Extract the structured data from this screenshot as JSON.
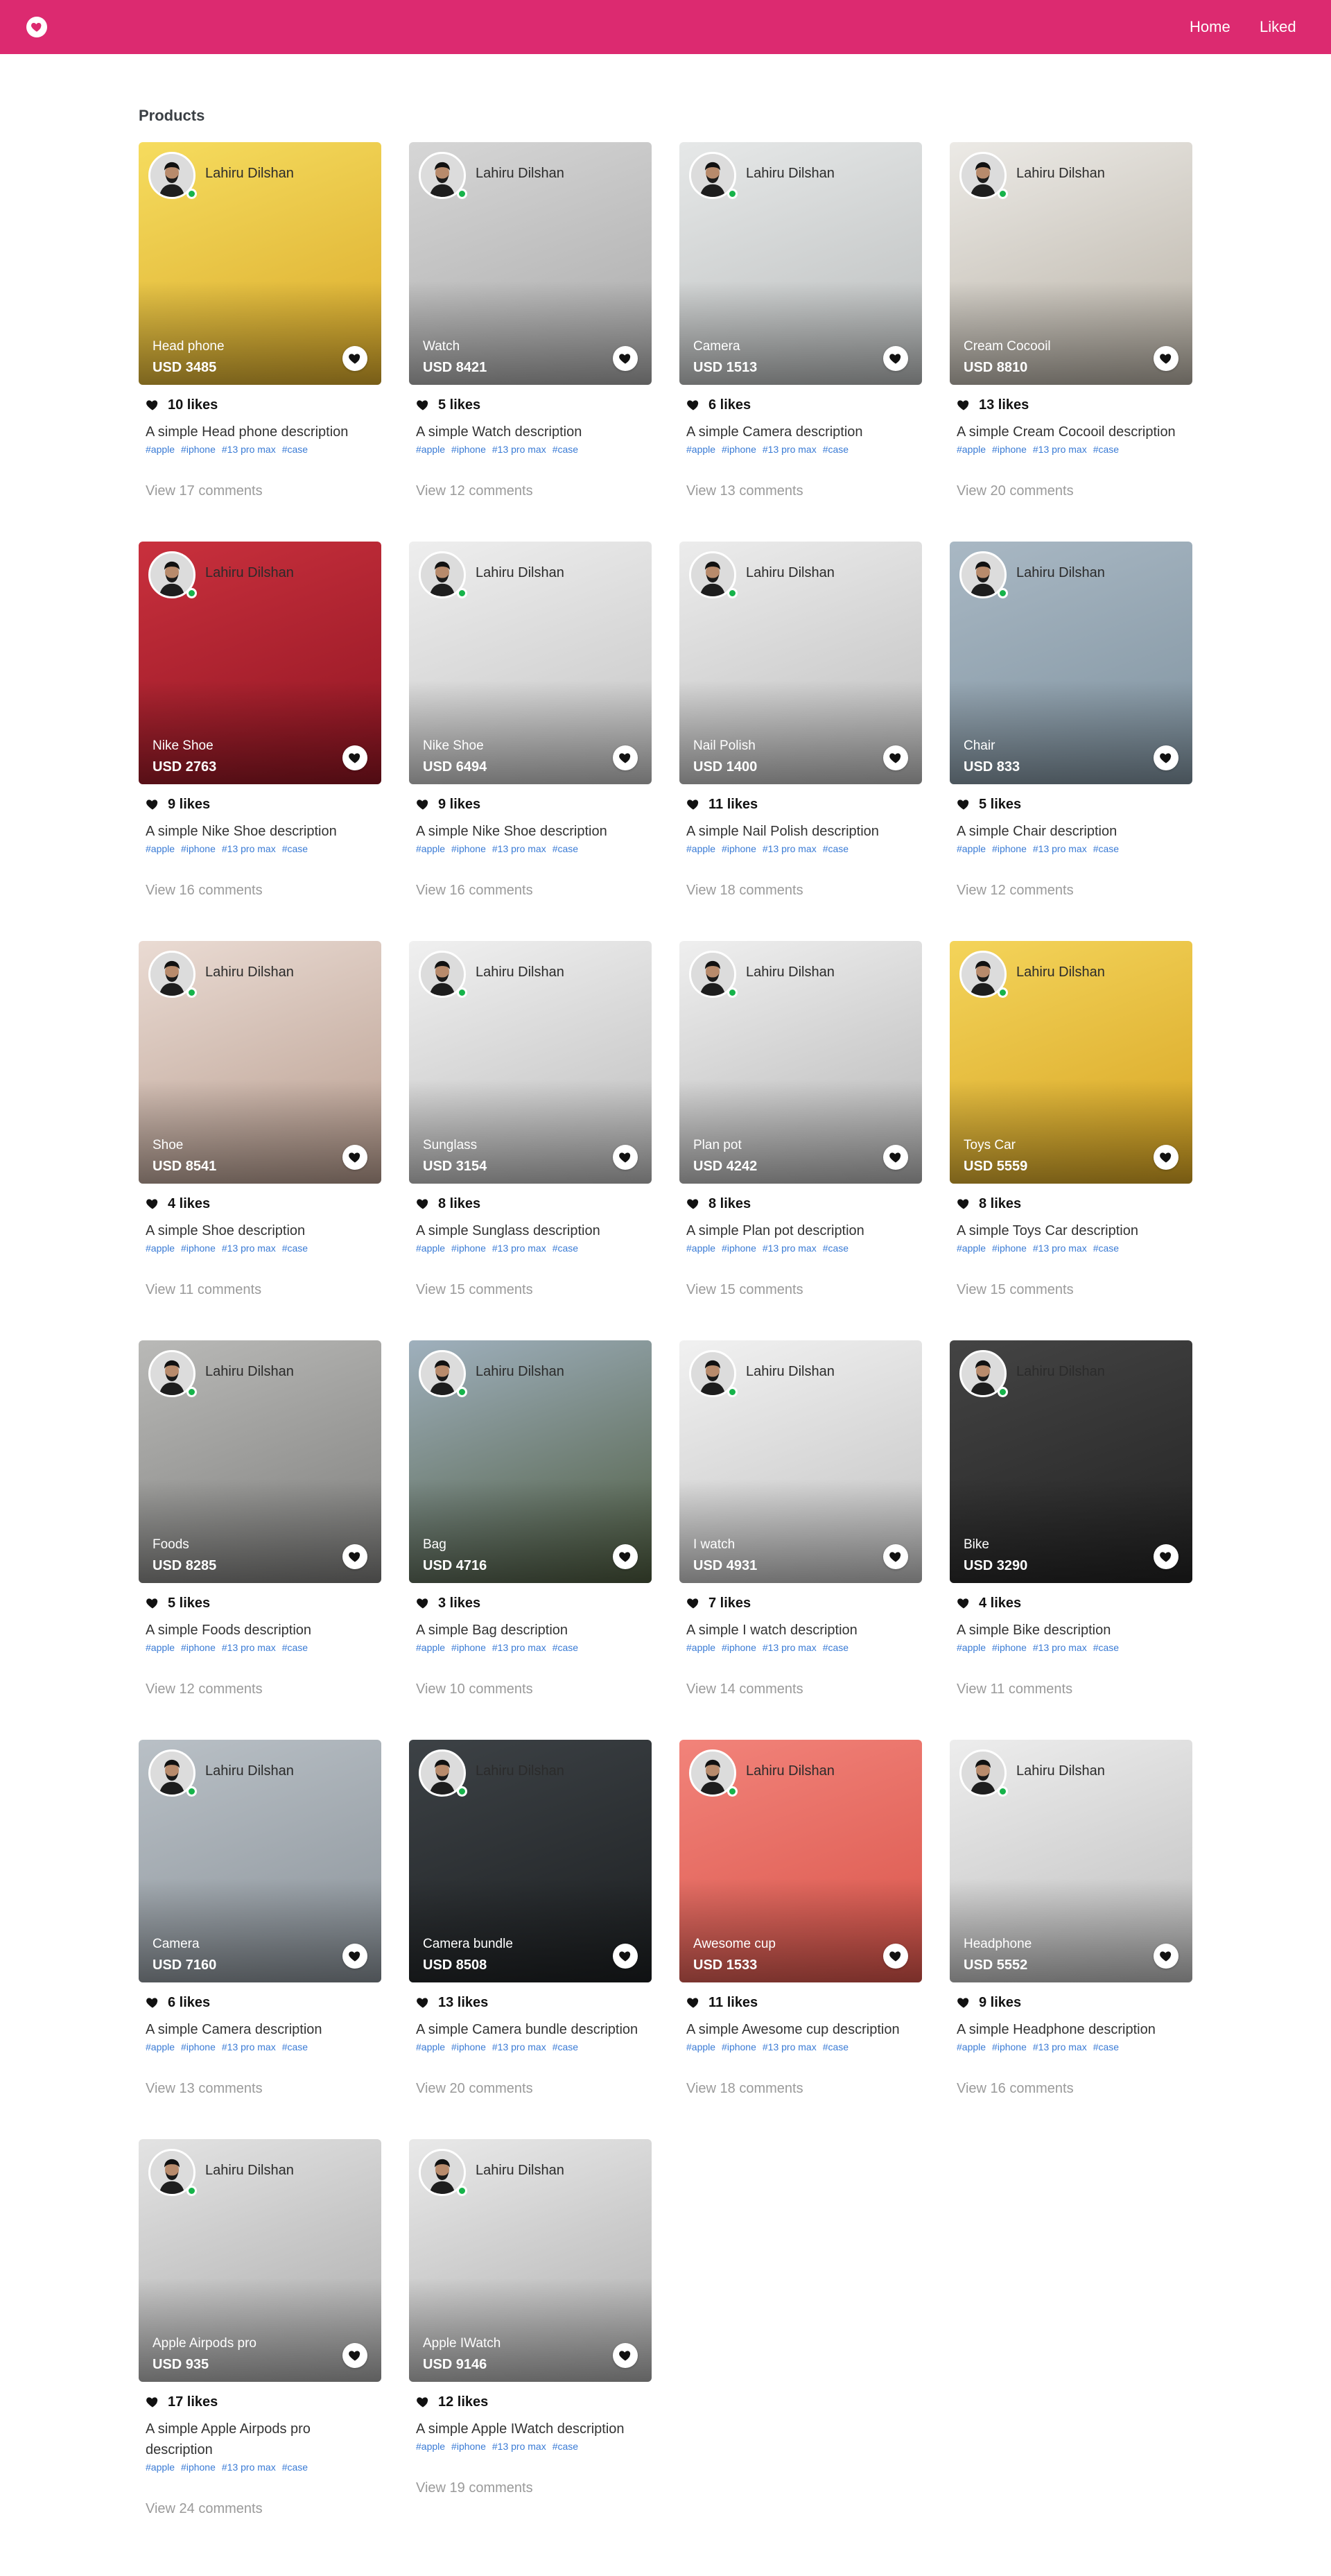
{
  "navbar": {
    "home": "Home",
    "liked": "Liked"
  },
  "page": {
    "title": "Products"
  },
  "author": "Lahiru Dilshan",
  "tags": [
    "#apple",
    "#iphone",
    "#13 pro max",
    "#case"
  ],
  "colors": {
    "brand": "#dc2a70",
    "online": "#16b34a",
    "tag": "#3a7bd5"
  },
  "products": [
    {
      "name": "Head phone",
      "price": "USD 3485",
      "likes": "10 likes",
      "description": "A simple Head phone description",
      "comments": "View 17 comments",
      "bg": [
        "#f6dc5e",
        "#d9a92a"
      ]
    },
    {
      "name": "Watch",
      "price": "USD 8421",
      "likes": "5 likes",
      "description": "A simple Watch description",
      "comments": "View 12 comments",
      "bg": [
        "#d6d6d6",
        "#a9a9a9"
      ]
    },
    {
      "name": "Camera",
      "price": "USD 1513",
      "likes": "6 likes",
      "description": "A simple Camera description",
      "comments": "View 13 comments",
      "bg": [
        "#e6e8e8",
        "#b9bcbc"
      ]
    },
    {
      "name": "Cream Cocooil",
      "price": "USD 8810",
      "likes": "13 likes",
      "description": "A simple Cream Cocooil description",
      "comments": "View 20 comments",
      "bg": [
        "#eceae6",
        "#b7b0a4"
      ]
    },
    {
      "name": "Nike Shoe",
      "price": "USD 2763",
      "likes": "9 likes",
      "description": "A simple Nike Shoe description",
      "comments": "View 16 comments",
      "bg": [
        "#c9303d",
        "#8f1522"
      ]
    },
    {
      "name": "Nike Shoe",
      "price": "USD 6494",
      "likes": "9 likes",
      "description": "A simple Nike Shoe description",
      "comments": "View 16 comments",
      "bg": [
        "#eeeeee",
        "#c4c4c4"
      ]
    },
    {
      "name": "Nail Polish",
      "price": "USD 1400",
      "likes": "11 likes",
      "description": "A simple Nail Polish description",
      "comments": "View 18 comments",
      "bg": [
        "#ececec",
        "#bdbdbd"
      ]
    },
    {
      "name": "Chair",
      "price": "USD 833",
      "likes": "5 likes",
      "description": "A simple Chair description",
      "comments": "View 12 comments",
      "bg": [
        "#a9b8c4",
        "#7f929f"
      ]
    },
    {
      "name": "Shoe",
      "price": "USD 8541",
      "likes": "4 likes",
      "description": "A simple Shoe description",
      "comments": "View 11 comments",
      "bg": [
        "#eadbd3",
        "#b79c8e"
      ]
    },
    {
      "name": "Sunglass",
      "price": "USD 3154",
      "likes": "8 likes",
      "description": "A simple Sunglass description",
      "comments": "View 15 comments",
      "bg": [
        "#f0f0f0",
        "#bcbcbc"
      ]
    },
    {
      "name": "Plan pot",
      "price": "USD 4242",
      "likes": "8 likes",
      "description": "A simple Plan pot description",
      "comments": "View 15 comments",
      "bg": [
        "#efefef",
        "#b5b5b5"
      ]
    },
    {
      "name": "Toys Car",
      "price": "USD 5559",
      "likes": "8 likes",
      "description": "A simple Toys Car description",
      "comments": "View 15 comments",
      "bg": [
        "#f4d45a",
        "#d6a322"
      ]
    },
    {
      "name": "Foods",
      "price": "USD 8285",
      "likes": "5 likes",
      "description": "A simple Foods description",
      "comments": "View 12 comments",
      "bg": [
        "#b9b9b7",
        "#7d7d7b"
      ]
    },
    {
      "name": "Bag",
      "price": "USD 4716",
      "likes": "3 likes",
      "description": "A simple Bag description",
      "comments": "View 10 comments",
      "bg": [
        "#9fb0bd",
        "#4c5a3e"
      ]
    },
    {
      "name": "I watch",
      "price": "USD 4931",
      "likes": "7 likes",
      "description": "A simple I watch description",
      "comments": "View 14 comments",
      "bg": [
        "#f1f1f1",
        "#c1c1c1"
      ]
    },
    {
      "name": "Bike",
      "price": "USD 3290",
      "likes": "4 likes",
      "description": "A simple Bike description",
      "comments": "View 11 comments",
      "bg": [
        "#444444",
        "#222222"
      ]
    },
    {
      "name": "Camera",
      "price": "USD 7160",
      "likes": "6 likes",
      "description": "A simple Camera description",
      "comments": "View 13 comments",
      "bg": [
        "#b9c0c6",
        "#8a9299"
      ]
    },
    {
      "name": "Camera bundle",
      "price": "USD 8508",
      "likes": "13 likes",
      "description": "A simple Camera bundle description",
      "comments": "View 20 comments",
      "bg": [
        "#3d4246",
        "#1c1f21"
      ]
    },
    {
      "name": "Awesome cup",
      "price": "USD 1533",
      "likes": "11 likes",
      "description": "A simple Awesome cup description",
      "comments": "View 18 comments",
      "bg": [
        "#f2837a",
        "#d9544a"
      ]
    },
    {
      "name": "Headphone",
      "price": "USD 5552",
      "likes": "9 likes",
      "description": "A simple Headphone description",
      "comments": "View 16 comments",
      "bg": [
        "#ededed",
        "#bdbdbd"
      ]
    },
    {
      "name": "Apple Airpods pro",
      "price": "USD 935",
      "likes": "17 likes",
      "description": "A simple Apple Airpods pro description",
      "comments": "View 24 comments",
      "bg": [
        "#e3e3e3",
        "#a9a9a9"
      ]
    },
    {
      "name": "Apple IWatch",
      "price": "USD 9146",
      "likes": "12 likes",
      "description": "A simple Apple IWatch description",
      "comments": "View 19 comments",
      "bg": [
        "#e9e9e9",
        "#aeaeae"
      ]
    }
  ]
}
